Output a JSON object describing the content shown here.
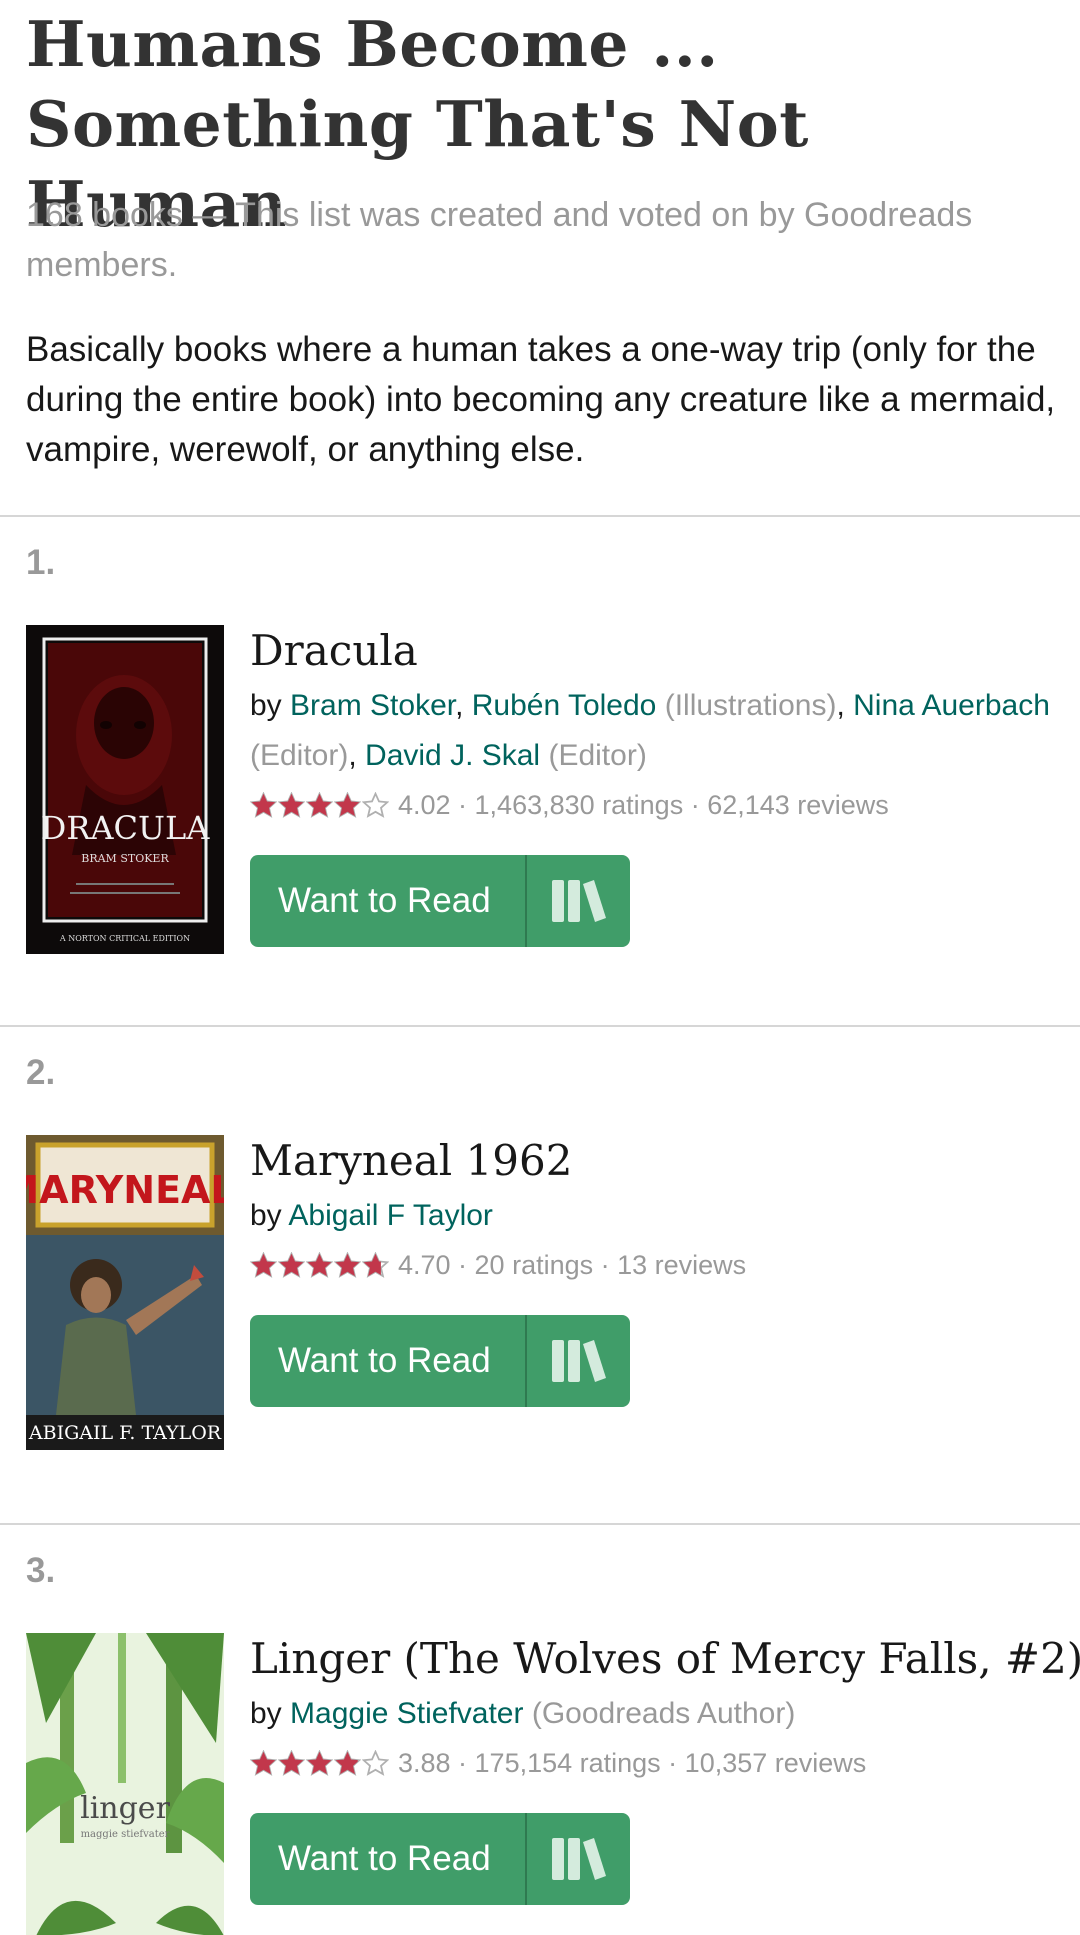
{
  "list": {
    "title": "Humans Become ... Something That's Not Human",
    "meta": "168 books — This list was created and voted on by Goodreads members.",
    "description": "Basically books where a human takes a one-way trip (only for the during the entire book) into becoming any creature like a mermaid, vampire, werewolf, or anything else."
  },
  "colors": {
    "author_link": "#00635d",
    "muted": "#999999",
    "button": "#409d69",
    "star": "#c2374b"
  },
  "books": [
    {
      "rank": "1.",
      "title": "Dracula",
      "by": "by ",
      "stars": 4.02,
      "stats": "4.02 · 1,463,830 ratings · 62,143 reviews",
      "want_to_read": "Want to Read",
      "cover_title": "DRACULA",
      "cover_author": "BRAM STOKER",
      "cover_footer": "A NORTON CRITICAL EDITION",
      "authors": [
        {
          "name": "Bram Stoker",
          "role": ""
        },
        {
          "name": "Rubén Toledo",
          "role": "(Illustrations)"
        },
        {
          "name": "Nina Auerbach",
          "role": "(Editor)"
        },
        {
          "name": "David J. Skal",
          "role": "(Editor)"
        }
      ]
    },
    {
      "rank": "2.",
      "title": "Maryneal 1962",
      "by": "by ",
      "stars": 4.7,
      "stats": "4.70 · 20 ratings · 13 reviews",
      "want_to_read": "Want to Read",
      "cover_title": "MARYNEAL",
      "cover_author": "ABIGAIL F. TAYLOR",
      "authors": [
        {
          "name": "Abigail F Taylor",
          "role": ""
        }
      ]
    },
    {
      "rank": "3.",
      "title": "Linger (The Wolves of Mercy Falls, #2)",
      "by": "by ",
      "stars": 3.88,
      "stats": "3.88 · 175,154 ratings · 10,357 reviews",
      "want_to_read": "Want to Read",
      "cover_title": "linger",
      "cover_author": "maggie stiefvater",
      "authors": [
        {
          "name": "Maggie Stiefvater",
          "role": "(Goodreads Author)"
        }
      ]
    }
  ]
}
